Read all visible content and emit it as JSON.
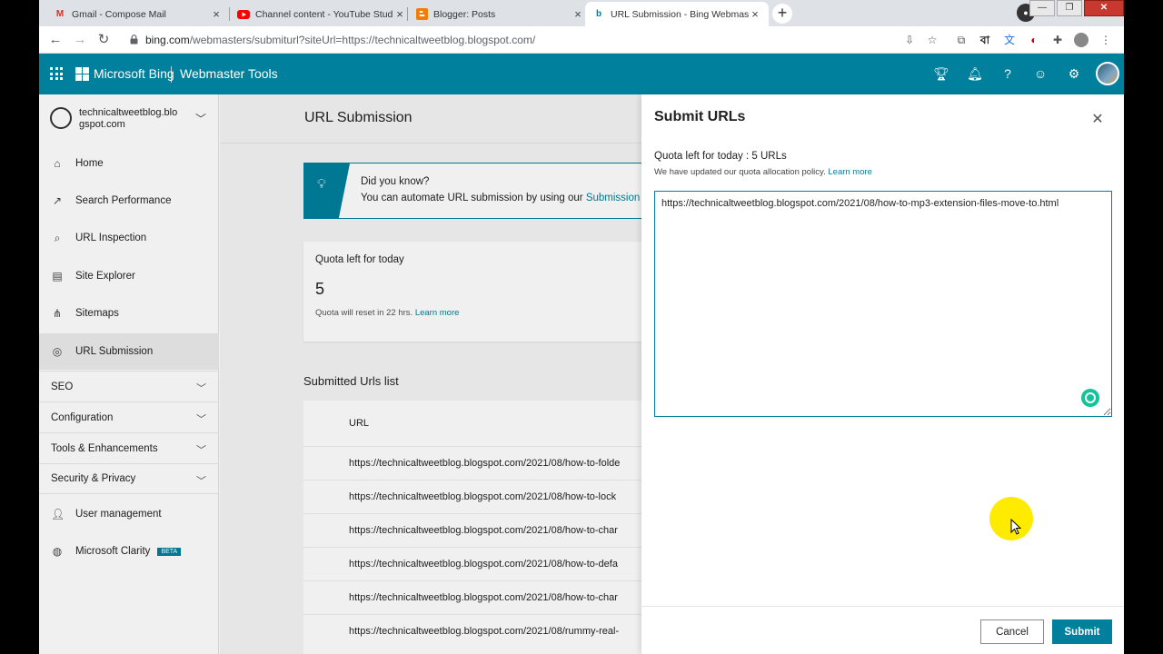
{
  "browser": {
    "tabs": [
      {
        "title": "Gmail - Compose Mail",
        "favicon": "gmail-icon",
        "color": "#d93025"
      },
      {
        "title": "Channel content - YouTube Studio",
        "favicon": "youtube-icon",
        "color": "#ff0000"
      },
      {
        "title": "Blogger: Posts",
        "favicon": "blogger-icon",
        "color": "#f57c00"
      },
      {
        "title": "URL Submission - Bing Webmaster",
        "favicon": "bing-icon",
        "color": "#00809d",
        "active": true
      }
    ],
    "address": {
      "host": "bing.com",
      "path": "/webmasters/submiturl?siteUrl=https://technicaltweetblog.blogspot.com/"
    },
    "extension_letter": "বা"
  },
  "header": {
    "brand": "Microsoft Bing",
    "product": "Webmaster Tools",
    "icons": [
      "trophy-icon",
      "bell-icon",
      "help-icon",
      "smiley-icon",
      "gear-icon",
      "avatar"
    ],
    "accent": "#00809d"
  },
  "sidebar": {
    "site_line1": "technicaltweetblog.blo",
    "site_line2": "gspot.com",
    "items": [
      {
        "label": "Home",
        "icon": "home-icon"
      },
      {
        "label": "Search Performance",
        "icon": "trend-icon"
      },
      {
        "label": "URL Inspection",
        "icon": "search-icon"
      },
      {
        "label": "Site Explorer",
        "icon": "document-icon"
      },
      {
        "label": "Sitemaps",
        "icon": "sitemap-icon"
      },
      {
        "label": "URL Submission",
        "icon": "globe-icon",
        "active": true
      }
    ],
    "groups": [
      {
        "label": "SEO"
      },
      {
        "label": "Configuration"
      },
      {
        "label": "Tools & Enhancements"
      },
      {
        "label": "Security & Privacy"
      }
    ],
    "user_management": "User management",
    "clarity": "Microsoft Clarity",
    "beta": "BETA"
  },
  "main": {
    "title": "URL Submission",
    "tip_title": "Did you know?",
    "tip_text": "You can automate URL submission by using our",
    "tip_link": "Submission",
    "quota_label": "Quota left for today",
    "quota_value": "5",
    "quota_reset": "Quota will reset in 22 hrs.",
    "quota_learn": "Learn more",
    "submitted_title": "Submitted Urls list",
    "col_url": "URL",
    "rows": [
      "https://technicaltweetblog.blogspot.com/2021/08/how-to-folde",
      "https://technicaltweetblog.blogspot.com/2021/08/how-to-lock",
      "https://technicaltweetblog.blogspot.com/2021/08/how-to-char",
      "https://technicaltweetblog.blogspot.com/2021/08/how-to-defa",
      "https://technicaltweetblog.blogspot.com/2021/08/how-to-char",
      "https://technicaltweetblog.blogspot.com/2021/08/rummy-real-"
    ]
  },
  "panel": {
    "title": "Submit URLs",
    "quota_prefix": "Quota left for today : ",
    "quota_value": "5 URLs",
    "policy": "We have updated our quota allocation policy.",
    "policy_link": "Learn more",
    "textarea_value": "https://technicaltweetblog.blogspot.com/2021/08/how-to-mp3-extension-files-move-to.html",
    "cancel": "Cancel",
    "submit": "Submit"
  }
}
